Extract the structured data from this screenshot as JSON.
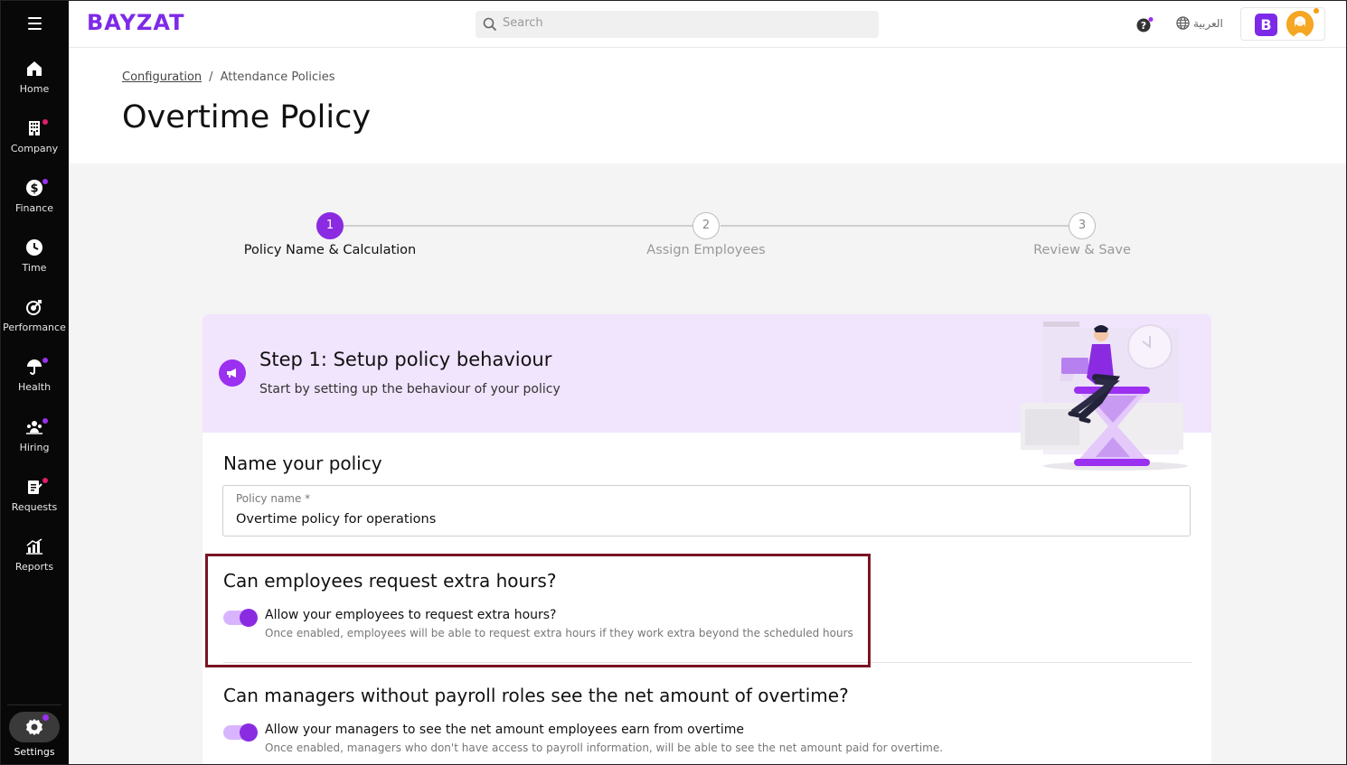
{
  "sidebar": {
    "items": [
      {
        "label": "Home",
        "icon": "home-icon",
        "dot": null
      },
      {
        "label": "Company",
        "icon": "building-icon",
        "dot": "#e11d6a"
      },
      {
        "label": "Finance",
        "icon": "dollar-icon",
        "dot": "#9b30f0"
      },
      {
        "label": "Time",
        "icon": "clock-icon",
        "dot": null
      },
      {
        "label": "Performance",
        "icon": "target-icon",
        "dot": null
      },
      {
        "label": "Health",
        "icon": "umbrella-icon",
        "dot": "#9b30f0"
      },
      {
        "label": "Hiring",
        "icon": "people-icon",
        "dot": "#9b30f0"
      },
      {
        "label": "Requests",
        "icon": "clipboard-icon",
        "dot": "#e11d6a"
      },
      {
        "label": "Reports",
        "icon": "chart-icon",
        "dot": null
      }
    ],
    "settings_label": "Settings"
  },
  "topbar": {
    "logo": "BAYZAT",
    "search_placeholder": "Search",
    "language": "العربية",
    "account_initial": "B"
  },
  "breadcrumb": {
    "parent": "Configuration",
    "current": "Attendance Policies"
  },
  "page_title": "Overtime Policy",
  "stepper": {
    "steps": [
      {
        "number": "1",
        "label": "Policy Name & Calculation",
        "active": true
      },
      {
        "number": "2",
        "label": "Assign Employees",
        "active": false
      },
      {
        "number": "3",
        "label": "Review & Save",
        "active": false
      }
    ]
  },
  "card": {
    "title": "Step 1: Setup policy behaviour",
    "subtitle": "Start by setting up the behaviour of your policy",
    "name_section_title": "Name your policy",
    "policy_name_label": "Policy name *",
    "policy_name_value": "Overtime policy for operations",
    "extra_hours": {
      "question": "Can employees request extra hours?",
      "toggle_label": "Allow your employees to request extra hours?",
      "toggle_desc": "Once enabled, employees will be able to request extra hours if they work extra beyond the scheduled hours",
      "enabled": true
    },
    "net_amount": {
      "question": "Can managers without payroll roles see the net amount of overtime?",
      "toggle_label": "Allow your managers to see the net amount employees earn from overtime",
      "toggle_desc": "Once enabled, managers who don't have access to payroll information, will be able to see the net amount paid for overtime.",
      "enabled": true
    }
  },
  "colors": {
    "accent": "#8a2be2",
    "highlight_border": "#7a1424",
    "card_header_bg": "#f1e4fd"
  }
}
